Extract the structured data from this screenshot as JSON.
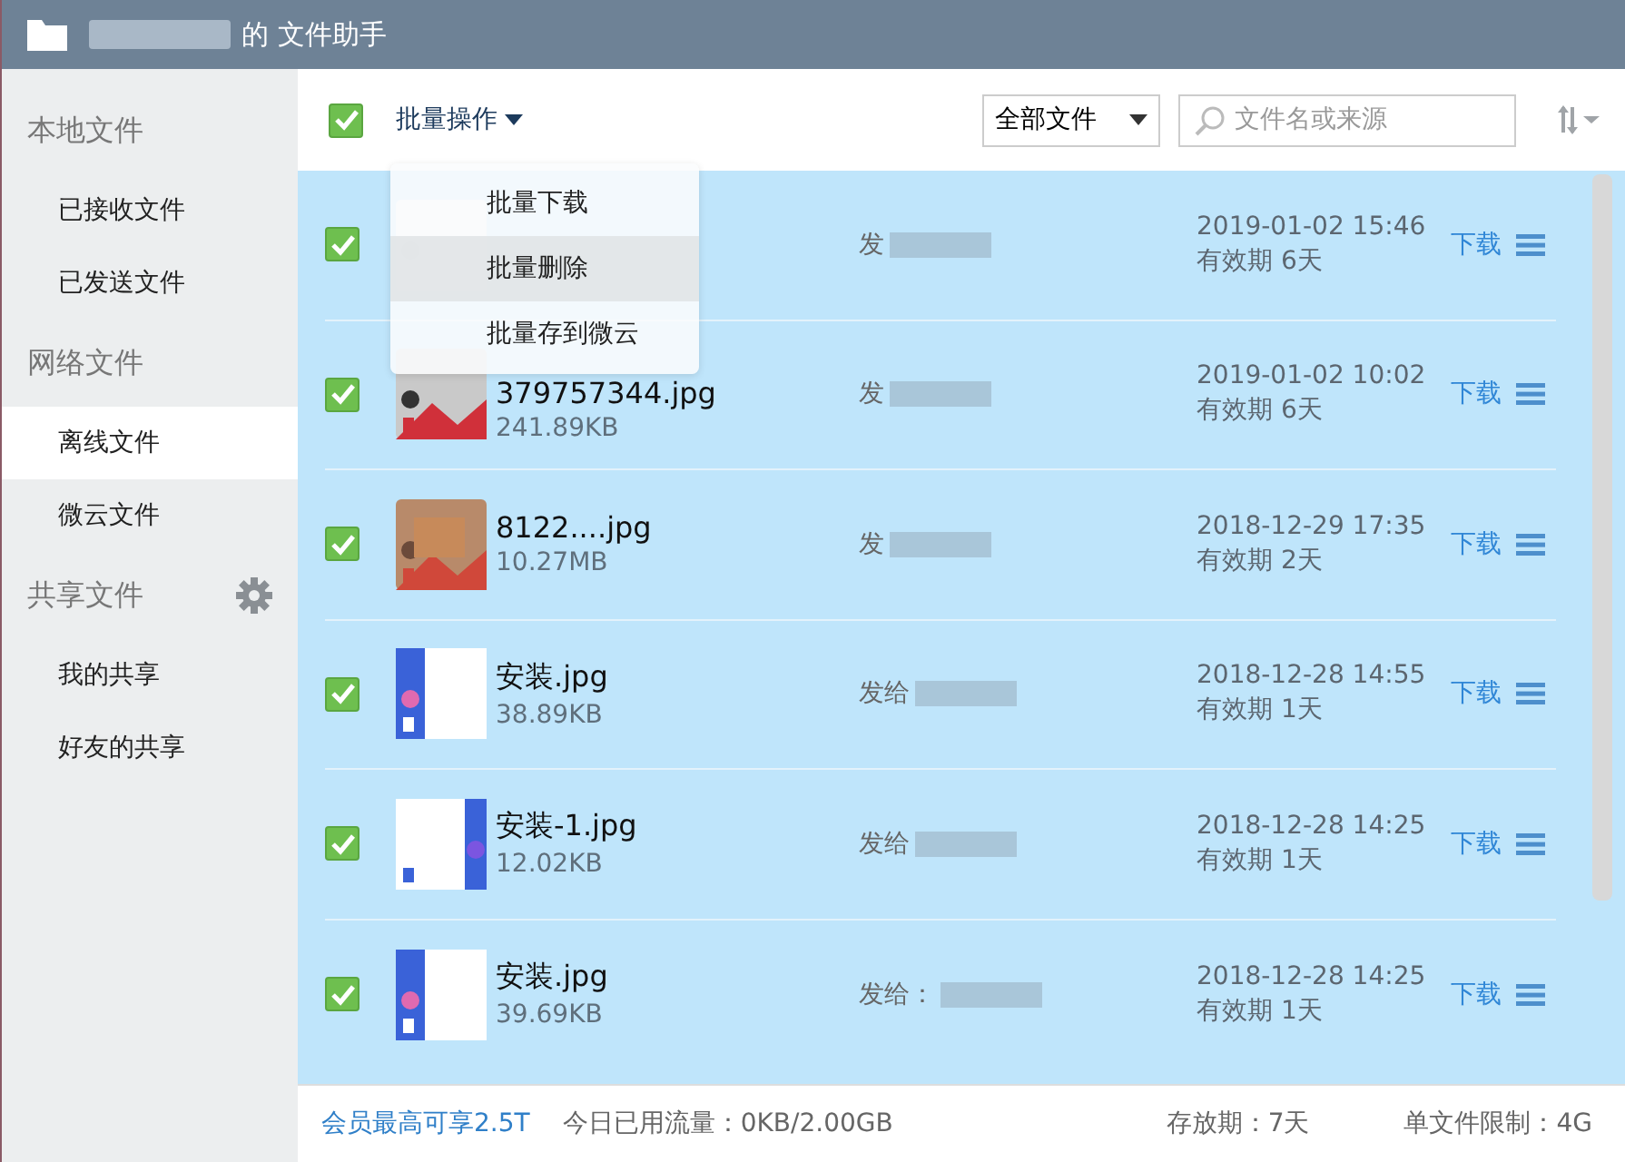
{
  "window": {
    "title": "的 文件助手"
  },
  "sidebar": {
    "groups": [
      {
        "label": "本地文件",
        "settings": false,
        "items": [
          {
            "label": "已接收文件",
            "selected": false
          },
          {
            "label": "已发送文件",
            "selected": false
          }
        ]
      },
      {
        "label": "网络文件",
        "settings": false,
        "items": [
          {
            "label": "离线文件",
            "selected": true
          },
          {
            "label": "微云文件",
            "selected": false
          }
        ]
      },
      {
        "label": "共享文件",
        "settings": true,
        "items": [
          {
            "label": "我的共享",
            "selected": false
          },
          {
            "label": "好友的共享",
            "selected": false
          }
        ]
      }
    ]
  },
  "toolbar": {
    "select_all": {
      "checked": true
    },
    "batch_label": "批量操作",
    "filter": "全部文件",
    "search": {
      "placeholder": "文件名或来源"
    }
  },
  "batch_menu": [
    {
      "label": "批量下载",
      "selected": false
    },
    {
      "label": "批量删除",
      "selected": true
    },
    {
      "label": "批量存到微云",
      "selected": false
    }
  ],
  "files": [
    {
      "checked": true,
      "sender": "发",
      "date": "2019-01-02 15:46",
      "expiry": "有效期 6天",
      "action": "下载"
    },
    {
      "checked": true,
      "name": "379757344.jpg",
      "size": "241.89KB",
      "sender": "发",
      "date": "2019-01-02 10:02",
      "expiry": "有效期 6天",
      "action": "下载"
    },
    {
      "checked": true,
      "name": "8122....jpg",
      "size": "10.27MB",
      "sender": "发",
      "date": "2018-12-29 17:35",
      "expiry": "有效期 2天",
      "action": "下载"
    },
    {
      "checked": true,
      "name": "安装.jpg",
      "size": "38.89KB",
      "sender": "发给",
      "date": "2018-12-28 14:55",
      "expiry": "有效期 1天",
      "action": "下载"
    },
    {
      "checked": true,
      "name": "安装-1.jpg",
      "size": "12.02KB",
      "sender": "发给",
      "date": "2018-12-28 14:25",
      "expiry": "有效期 1天",
      "action": "下载"
    },
    {
      "checked": true,
      "name": "安装.jpg",
      "size": "39.69KB",
      "sender": "发给：",
      "date": "2018-12-28 14:25",
      "expiry": "有效期 1天",
      "action": "下载"
    }
  ],
  "status_bar": {
    "promo": "会员最高可享2.5T",
    "traffic": "今日已用流量：0KB/2.00GB",
    "retention": "存放期：7天",
    "limit": "单文件限制：4G"
  }
}
